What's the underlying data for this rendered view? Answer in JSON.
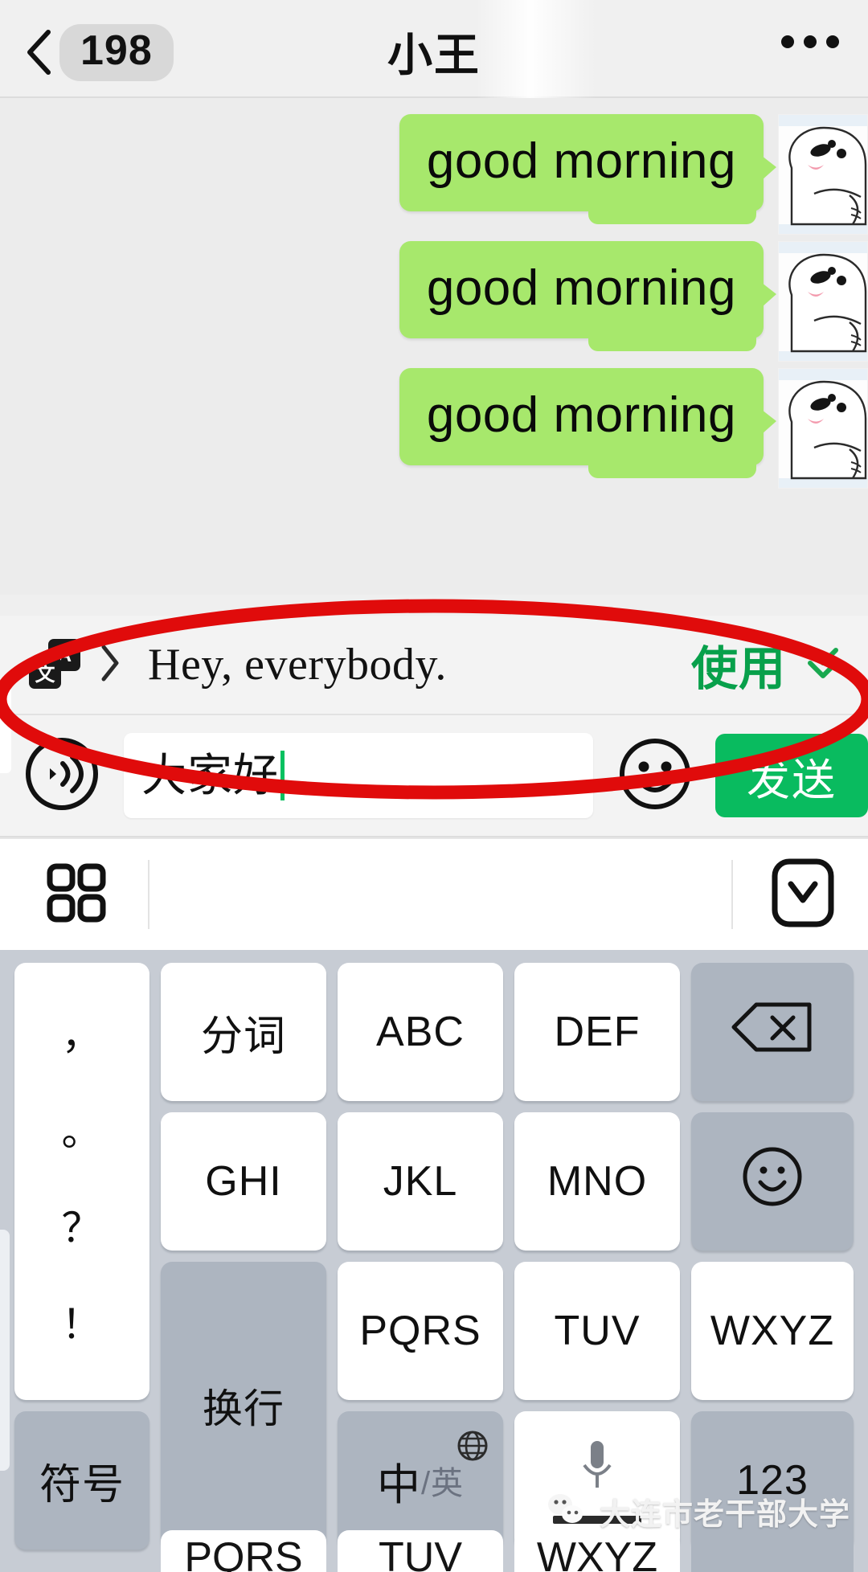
{
  "header": {
    "back_icon": "chevron-left-icon",
    "unread_count": "198",
    "title": "小王",
    "more_icon": "more-horizontal-icon"
  },
  "chat": {
    "messages": [
      {
        "text": "good morning",
        "side": "outgoing",
        "avatar": "bear-avatar"
      },
      {
        "text": "good morning",
        "side": "outgoing",
        "avatar": "bear-avatar"
      },
      {
        "text": "good morning",
        "side": "outgoing",
        "avatar": "bear-avatar"
      }
    ],
    "bubble_color": "#a7e86c"
  },
  "annotation": {
    "shape": "ellipse",
    "color": "#e00000",
    "target": "translation-suggestion-row"
  },
  "translation_row": {
    "translate_icon": "translate-icon",
    "translate_icon_back_label": "A",
    "translate_icon_front_label": "文",
    "expand_icon": "chevron-right-icon",
    "translated_text": "Hey, everybody.",
    "use_label": "使用",
    "use_color": "#08a04b",
    "collapse_icon": "chevrons-down-icon"
  },
  "input_bar": {
    "voice_icon": "voice-input-icon",
    "value": "大家好",
    "placeholder": "",
    "caret_color": "#07c160",
    "emoji_icon": "emoji-smiley-icon",
    "send_label": "发送",
    "send_color": "#09bb5f"
  },
  "keyboard_toolbar": {
    "grid_icon": "app-grid-icon",
    "hide_icon": "hide-keyboard-icon"
  },
  "keypad": {
    "punct_key": [
      "，",
      "。",
      "？",
      "！"
    ],
    "rows": [
      [
        {
          "label": "分词",
          "type": "normal",
          "name": "key-fenci"
        },
        {
          "label": "ABC",
          "type": "normal",
          "name": "key-abc"
        },
        {
          "label": "DEF",
          "type": "normal",
          "name": "key-def"
        },
        {
          "label": "",
          "type": "fn",
          "name": "key-backspace",
          "icon": "backspace-icon"
        }
      ],
      [
        {
          "label": "GHI",
          "type": "normal",
          "name": "key-ghi"
        },
        {
          "label": "JKL",
          "type": "normal",
          "name": "key-jkl"
        },
        {
          "label": "MNO",
          "type": "normal",
          "name": "key-mno"
        },
        {
          "label": "",
          "type": "fn",
          "name": "key-emoji",
          "icon": "smiley-icon"
        }
      ],
      [
        {
          "label": "PQRS",
          "type": "normal",
          "name": "key-pqrs"
        },
        {
          "label": "TUV",
          "type": "normal",
          "name": "key-tuv"
        },
        {
          "label": "WXYZ",
          "type": "normal",
          "name": "key-wxyz"
        },
        {
          "label": "换行",
          "type": "fn",
          "name": "key-enter"
        }
      ],
      [
        {
          "label": "符号",
          "type": "fn",
          "name": "key-symbols"
        },
        {
          "label": "中",
          "sublabel": "/英",
          "type": "fn",
          "name": "key-lang",
          "icon": "globe-icon"
        },
        {
          "label": "",
          "type": "normal",
          "name": "key-space",
          "icon": "microphone-icon"
        },
        {
          "label": "123",
          "type": "fn",
          "name": "key-123"
        }
      ]
    ],
    "peek_row": [
      "",
      "PQRS",
      "TUV",
      "WXYZ",
      ""
    ]
  },
  "watermark": {
    "logo": "wechat-logo",
    "text": "大连市老干部大学"
  }
}
